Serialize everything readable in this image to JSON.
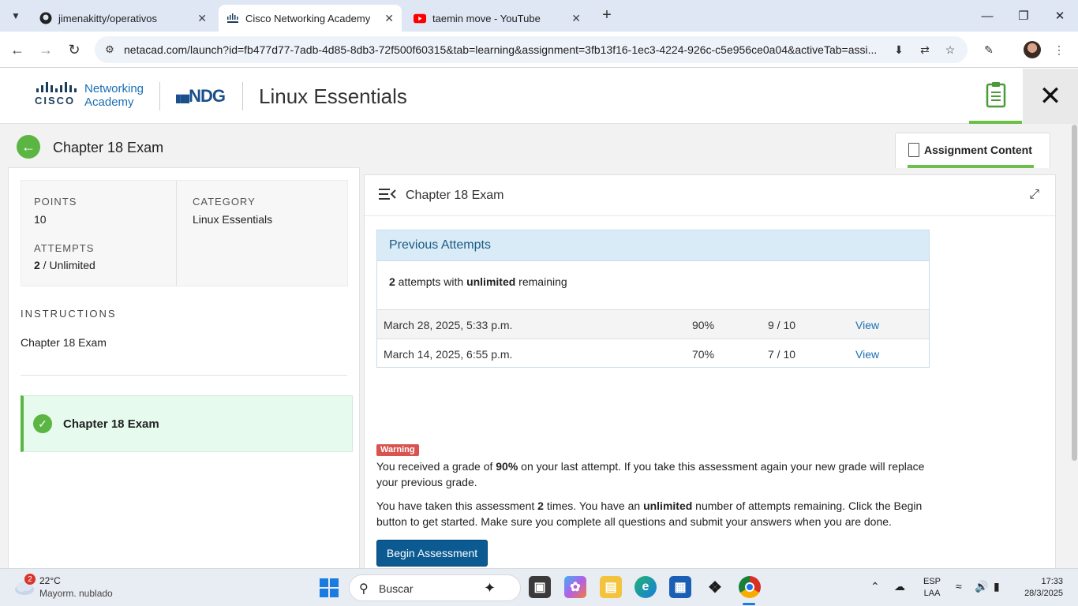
{
  "browser": {
    "tabs": [
      {
        "title": "jimenakitty/operativos",
        "icon": "github-icon"
      },
      {
        "title": "Cisco Networking Academy",
        "icon": "cisco-icon"
      },
      {
        "title": "taemin move - YouTube",
        "icon": "youtube-icon"
      }
    ],
    "url": "netacad.com/launch?id=fb477d77-7adb-4d85-8db3-72f500f60315&tab=learning&assignment=3fb13f16-1ec3-4224-926c-c5e956ce0a04&activeTab=assi..."
  },
  "header": {
    "brand_line1": "Networking",
    "brand_line2": "Academy",
    "cisco_word": "CISCO",
    "partner": "NDG",
    "course_title": "Linux Essentials"
  },
  "page": {
    "title": "Chapter 18 Exam",
    "assignment_tab": "Assignment Content"
  },
  "info": {
    "points_label": "POINTS",
    "points_value": "10",
    "category_label": "CATEGORY",
    "category_value": "Linux Essentials",
    "attempts_label": "ATTEMPTS",
    "attempts_count": "2",
    "attempts_rest": " / Unlimited",
    "instructions_label": "INSTRUCTIONS",
    "instructions_value": "Chapter 18 Exam"
  },
  "sidebar_item": {
    "title": "Chapter 18 Exam"
  },
  "content": {
    "title": "Chapter 18 Exam",
    "previous_attempts_heading": "Previous Attempts",
    "summary_count": "2",
    "summary_mid": " attempts with ",
    "summary_bold": "unlimited",
    "summary_end": " remaining",
    "attempts": [
      {
        "date": "March 28, 2025, 5:33 p.m.",
        "percent": "90%",
        "score": "9 / 10",
        "link": "View"
      },
      {
        "date": "March 14, 2025, 6:55 p.m.",
        "percent": "70%",
        "score": "7 / 10",
        "link": "View"
      }
    ],
    "warning_badge": "Warning",
    "warn_p1_a": "You received a grade of ",
    "warn_p1_b": "90%",
    "warn_p1_c": " on your last attempt. If you take this assessment again your new grade will replace your previous grade.",
    "warn_p2_a": "You have taken this assessment ",
    "warn_p2_b": "2",
    "warn_p2_c": " times. You have an ",
    "warn_p2_d": "unlimited",
    "warn_p2_e": " number of attempts remaining. Click the Begin button to get started. Make sure you complete all questions and submit your answers when you are done.",
    "begin_button": "Begin Assessment"
  },
  "taskbar": {
    "weather_badge": "2",
    "temperature": "22°C",
    "weather_desc": "Mayorm. nublado",
    "search_placeholder": "Buscar",
    "lang_line1": "ESP",
    "lang_line2": "LAA",
    "time": "17:33",
    "date": "28/3/2025"
  }
}
